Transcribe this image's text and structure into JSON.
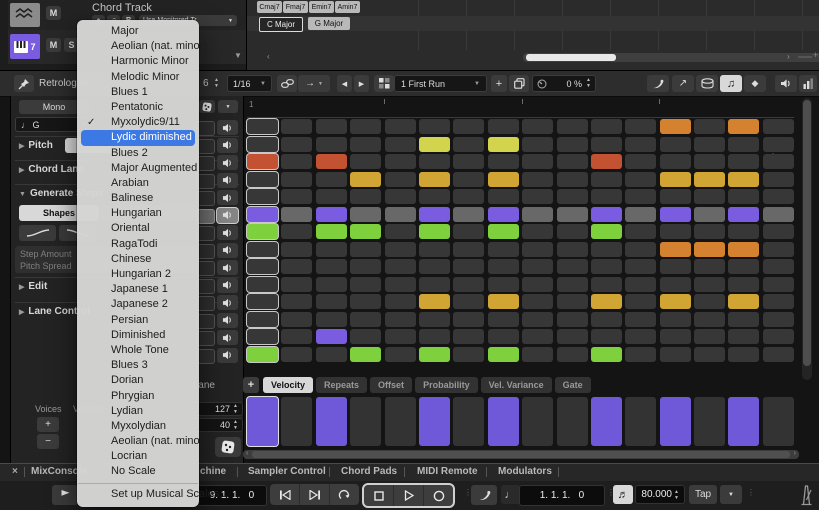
{
  "tracks": {
    "track1": {
      "mute": "M"
    },
    "track2": {
      "number": "7",
      "mute": "M",
      "solo": "S"
    }
  },
  "chord_track_panel": {
    "title": "Chord Track",
    "record_label": "R",
    "monitor_dropdown": "Use Monitored Tr"
  },
  "events": {
    "chords": [
      "Cmaj7",
      "Fmaj7",
      "Emin7",
      "Amin7"
    ],
    "scales": [
      "C Major",
      "G Major"
    ]
  },
  "toolbar": {
    "plugin": "Retrologue",
    "step_count": "6",
    "quantize": "1/16",
    "pattern": "1 First Run",
    "swing": "0 %"
  },
  "menu": {
    "items": [
      "Major",
      "Aeolian (nat. minor)",
      "Harmonic Minor",
      "Melodic Minor",
      "Blues 1",
      "Pentatonic",
      "Myxolydic9/11",
      "Lydic diminished",
      "Blues 2",
      "Major Augmented",
      "Arabian",
      "Balinese",
      "Hungarian",
      "Oriental",
      "RagaTodi",
      "Chinese",
      "Hungarian 2",
      "Japanese 1",
      "Japanese 2",
      "Persian",
      "Diminished",
      "Whole Tone",
      "Blues 3",
      "Dorian",
      "Phrygian",
      "Lydian",
      "Myxolydian",
      "Aeolian (nat. minor)",
      "Locrian",
      "No Scale"
    ],
    "checked_index": 6,
    "selected_index": 7,
    "check_glyph": "✓",
    "footer": "Set up Musical Scales..."
  },
  "inspector": {
    "mono": "Mono",
    "key": "G",
    "pitch": "Pitch",
    "chord_lane": "Chord Lane",
    "generate": "Generate Steps",
    "shapes": "Shapes",
    "step_amount": "Step Amount",
    "pitch_spread": "Pitch Spread",
    "edit": "Edit",
    "lane_control": "Lane Control",
    "voices": "Voices",
    "velocity_label": "Velocity",
    "voices_value": "127",
    "velocity_value": "40",
    "lane": "Lane"
  },
  "grid": {
    "ruler_start": "1",
    "rows": [
      "............O.O.",
      ".....Y.Y........",
      "R.R.......R.....",
      "...G.G.G....GGG.",
      "................",
      "PXPXXPXPXXPXPXPX",
      "N.NN.N.N..N.....",
      "............OOO.",
      "................",
      "................",
      ".....G.G..G.G.G.",
      "................",
      "..P.............",
      "N..N.N.N..N....."
    ],
    "velocity_row": "V.V..V.V..V.V.V.",
    "active_audition_row": 5
  },
  "lane_tabs": {
    "labels": [
      "Velocity",
      "Repeats",
      "Offset",
      "Probability",
      "Vel. Variance",
      "Gate"
    ],
    "active_index": 0
  },
  "bottom_tabs": {
    "close": "×",
    "mixconsole": "MixConsole",
    "partial": "chine",
    "tabs": [
      "Sampler Control",
      "Chord Pads",
      "MIDI Remote",
      "Modulators"
    ]
  },
  "transport": {
    "primary_time": "9. 1. 1.   0",
    "secondary_time": "1. 1. 1.   0",
    "tempo": "80.000",
    "tap": "Tap"
  },
  "colors": {
    "cells": {
      "O": "#d4822f",
      "R": "#c25232",
      "Y": "#d2d44e",
      "G": "#d0a534",
      "P": "#7a5ce1",
      "N": "#7ed13c",
      "X": "#686868",
      "V": "#7059d8"
    },
    "menu_highlight": "#3c79e5",
    "track_accent": "#7a5ce1"
  },
  "glyphs": {
    "dropdown_arrow": "▼",
    "left_arrow": "◀",
    "right_arrow": "▶",
    "arrow_up_right": "↗",
    "note_pair": "♫",
    "beamed_notes": "♬",
    "quarter_note": "♩",
    "diamond": "◆",
    "gear": "⚙",
    "plus": "+",
    "minus": "−",
    "right_to": "→"
  }
}
